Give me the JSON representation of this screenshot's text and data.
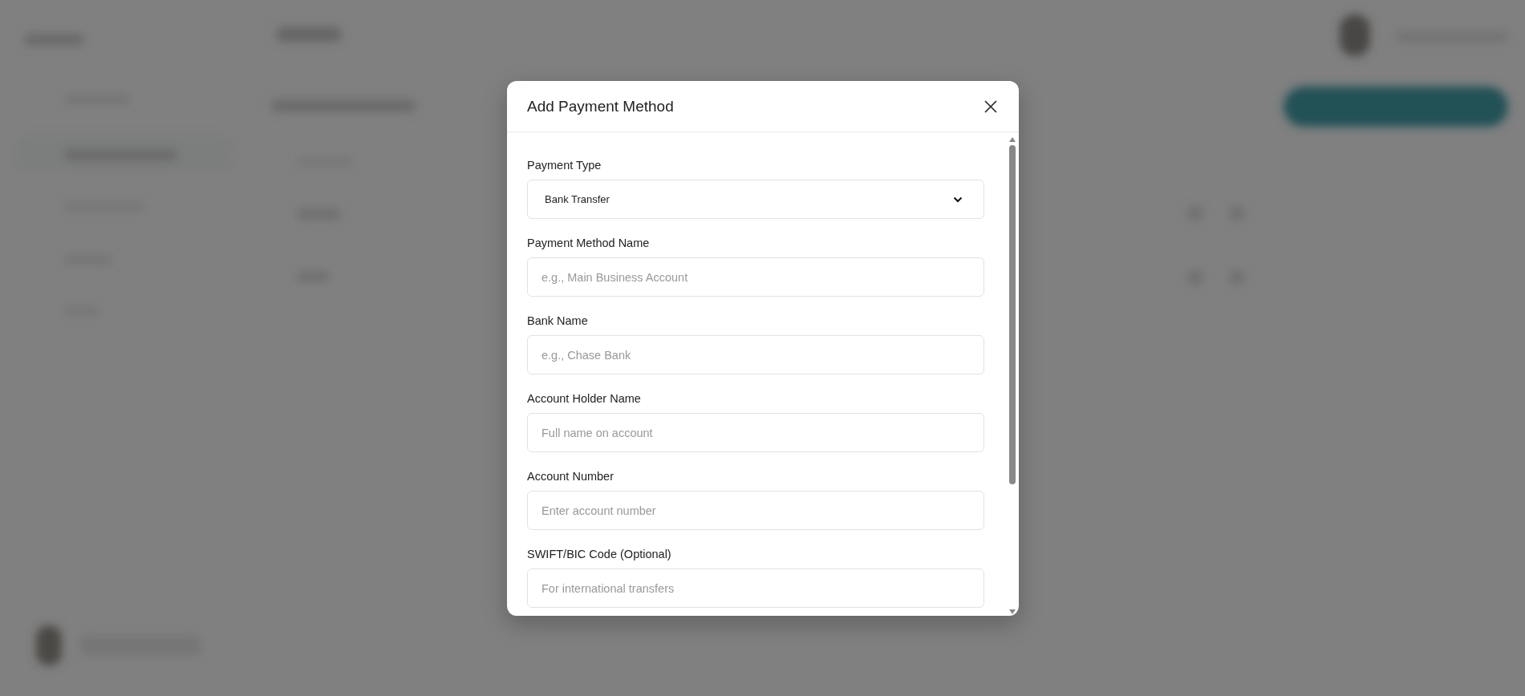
{
  "dialog": {
    "title": "Add Payment Method",
    "fields": [
      {
        "kind": "select",
        "label": "Payment Type",
        "value": "Bank Transfer"
      },
      {
        "kind": "text",
        "label": "Payment Method Name",
        "placeholder": "e.g., Main Business Account"
      },
      {
        "kind": "text",
        "label": "Bank Name",
        "placeholder": "e.g., Chase Bank"
      },
      {
        "kind": "text",
        "label": "Account Holder Name",
        "placeholder": "Full name on account"
      },
      {
        "kind": "text",
        "label": "Account Number",
        "placeholder": "Enter account number"
      },
      {
        "kind": "text",
        "label": "SWIFT/BIC Code (Optional)",
        "placeholder": "For international transfers"
      }
    ]
  }
}
